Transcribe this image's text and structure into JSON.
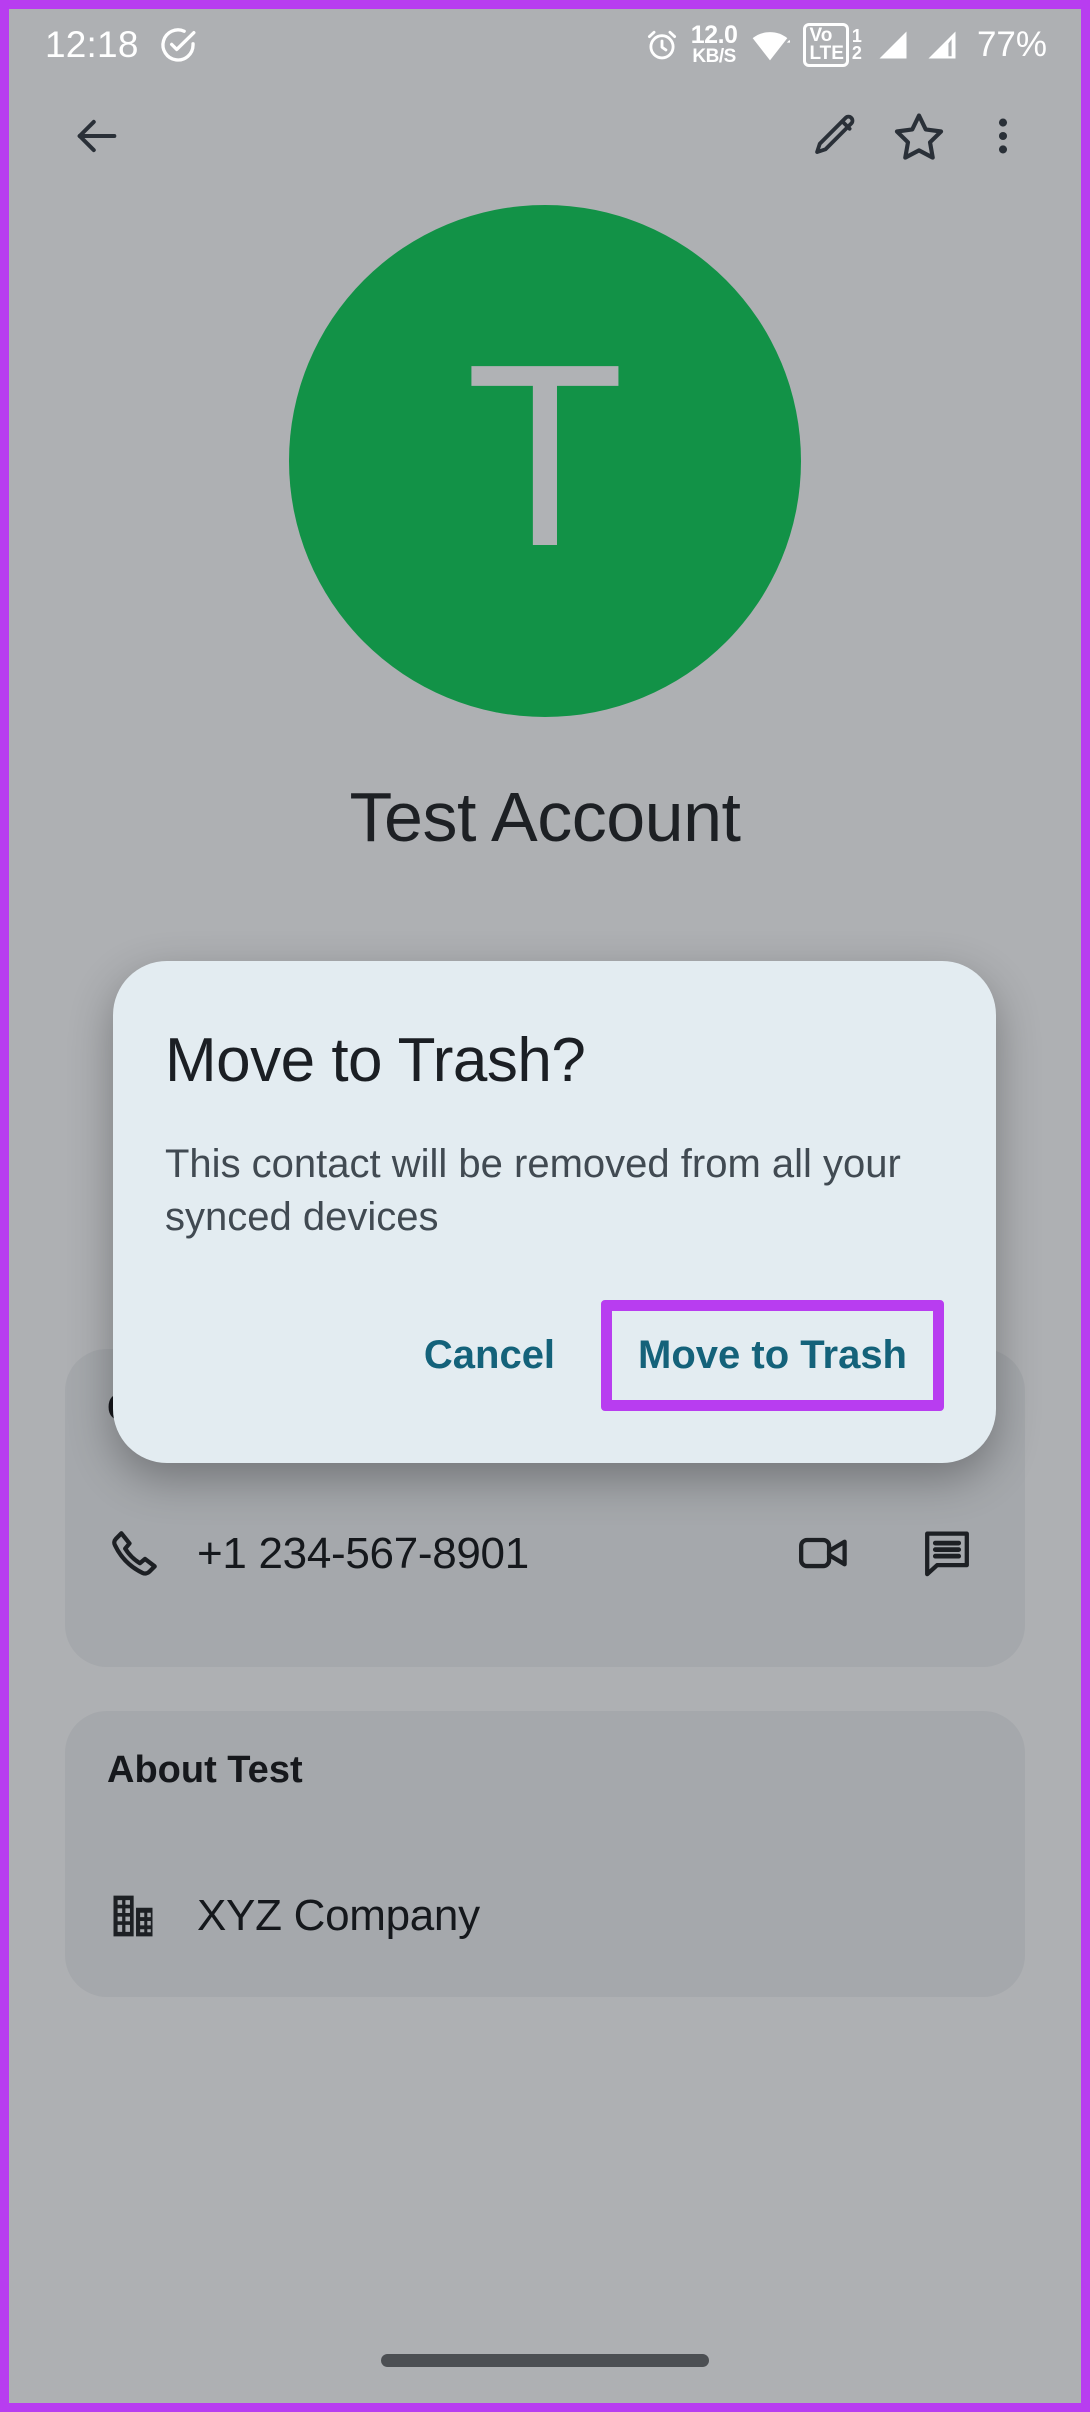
{
  "theme": {
    "page_background": "#aeb0b3",
    "card_background": "#a5a8ac",
    "dialog_background": "#e3ecf1",
    "accent_teal": "#14627a",
    "avatar_green": "#129247",
    "annotation_purple": "#b83df0",
    "text_primary": "#15181c"
  },
  "status_bar": {
    "clock": "12:18",
    "sync_icon": "check-circle-icon",
    "alarm_icon": "alarm-clock-icon",
    "net_speed_value": "12.0",
    "net_speed_unit": "KB/S",
    "wifi_icon": "wifi-icon",
    "volte_line1": "Vo",
    "volte_line2": "LTE",
    "volte_sim1": "1",
    "volte_sim2": "2",
    "signal_icon_1": "signal-bars-icon",
    "signal_icon_2": "signal-bars-icon",
    "battery_percent": "77%"
  },
  "toolbar": {
    "back_icon": "arrow-left-icon",
    "edit_icon": "pencil-icon",
    "favorite_icon": "star-outline-icon",
    "overflow_icon": "more-vertical-icon"
  },
  "contact": {
    "avatar_initial": "T",
    "name": "Test Account"
  },
  "contact_info_card": {
    "title": "Contact info",
    "phone": {
      "icon": "phone-icon",
      "number": "+1 234-567-8901",
      "video_call_icon": "video-camera-icon",
      "message_icon": "message-icon"
    }
  },
  "about_card": {
    "title": "About Test",
    "company": {
      "icon": "office-building-icon",
      "name": "XYZ Company"
    }
  },
  "dialog": {
    "title": "Move to Trash?",
    "message": "This contact will be removed from all your synced devices",
    "cancel_label": "Cancel",
    "confirm_label": "Move to Trash"
  },
  "nav_bar": {
    "home_indicator": "home-gesture-bar"
  }
}
